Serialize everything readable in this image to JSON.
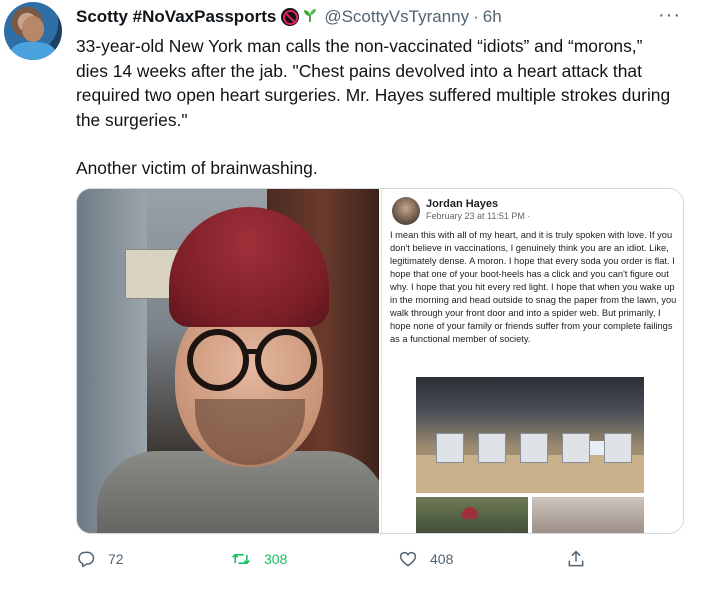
{
  "tweet": {
    "author": {
      "display_name": "Scotty #NoVaxPassports",
      "badge_icon": "no-entry-icon",
      "sprout_icon": "seedling-icon",
      "handle": "@ScottyVsTyranny",
      "separator": "·",
      "time": "6h"
    },
    "more_label": "···",
    "paragraphs": [
      "33-year-old New York man calls the non-vaccinated “idiots” and “morons,” dies 14 weeks after the jab. \"Chest pains devolved into a heart attack that required two open heart surgeries. Mr. Hayes suffered multiple strokes during the surgeries.\"",
      "Another victim of brainwashing."
    ],
    "embedded_post": {
      "name": "Jordan Hayes",
      "date": "February 23 at 11:51 PM ·",
      "text": "I mean this with all of my heart, and it is truly spoken with love. If you don't believe in vaccinations, I genuinely think you are an idiot. Like, legitimately dense. A moron. I hope that every soda you order is flat. I hope that one of your boot-heels has a click and you can't figure out why. I hope that you hit every red light. I hope that when you wake up in the morning and head outside to snag the paper from the lawn, you walk through your front door and into a spider web. But primarily, I hope none of your family or friends suffer from your complete failings as a functional member of society."
    },
    "actions": {
      "replies": "72",
      "retweets": "308",
      "likes": "408",
      "retweet_color": "#17bf63"
    }
  }
}
